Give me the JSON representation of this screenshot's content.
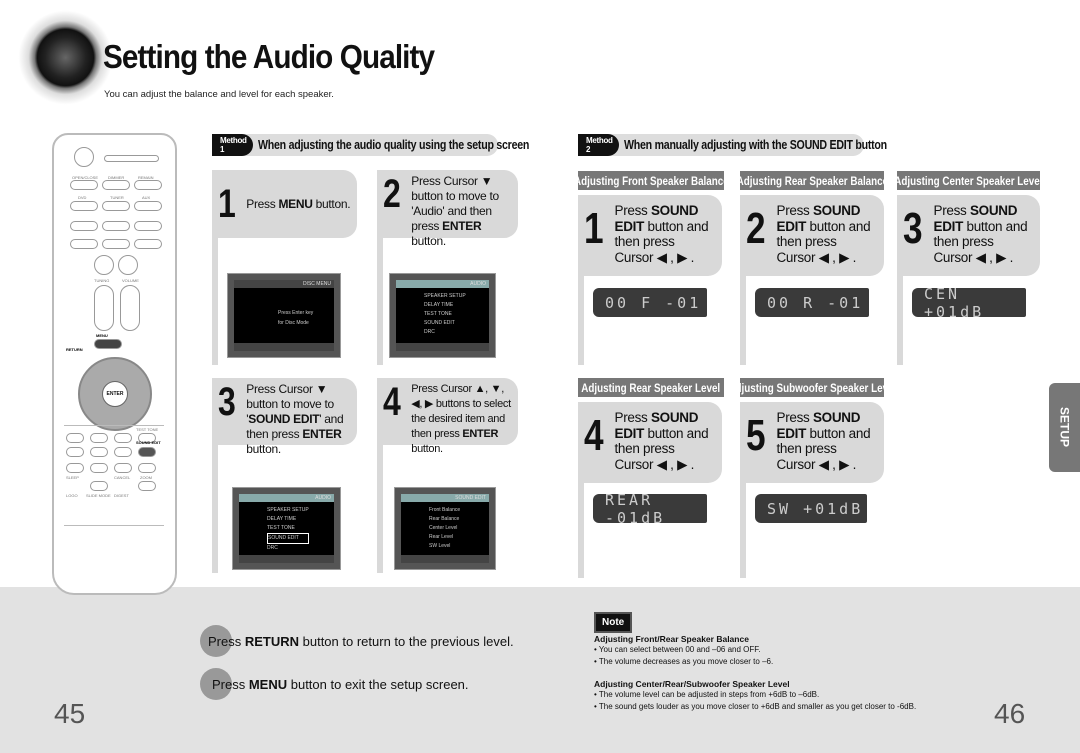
{
  "header": {
    "title": "Setting the Audio Quality",
    "subtitle": "You can adjust the balance and level for each speaker."
  },
  "method1": {
    "tag": "Method 1",
    "title": "When adjusting the audio quality using the setup screen",
    "steps": [
      {
        "num": "1",
        "text": "Press MENU button."
      },
      {
        "num": "2",
        "text": "Press Cursor ▼ button to move to 'Audio' and then press ENTER button."
      },
      {
        "num": "3",
        "text": "Press Cursor ▼ button to move to 'SOUND EDIT' and then press ENTER button."
      },
      {
        "num": "4",
        "text": "Press Cursor ▲, ▼, ◀, ▶ buttons to select the desired item and then press ENTER button."
      }
    ],
    "screens": [
      {
        "header": "DISC MENU",
        "items": [
          "Press Enter key",
          "for Disc Mode"
        ]
      },
      {
        "header": "AUDIO",
        "items": [
          "SPEAKER SETUP",
          "DELAY TIME",
          "TEST TONE",
          "SOUND EDIT",
          "DRC"
        ]
      },
      {
        "header": "AUDIO",
        "items": [
          "SPEAKER SETUP",
          "DELAY TIME",
          "TEST TONE",
          "SOUND EDIT",
          "DRC"
        ]
      },
      {
        "header": "SOUND EDIT",
        "items": [
          "Front Balance",
          "Rear Balance",
          "Center Level",
          "Rear Level",
          "SW Level"
        ]
      }
    ]
  },
  "method2": {
    "tag": "Method 2",
    "title": "When manually adjusting with the SOUND EDIT button",
    "sections": [
      {
        "header": "Adjusting Front Speaker Balance",
        "num": "1",
        "display": "00 F -01"
      },
      {
        "header": "Adjusting Rear Speaker Balance",
        "num": "2",
        "display": "00 R -01"
      },
      {
        "header": "Adjusting Center Speaker Level",
        "num": "3",
        "display": "CEN +01dB"
      },
      {
        "header": "Adjusting Rear Speaker Level",
        "num": "4",
        "display": "REAR -01dB"
      },
      {
        "header": "Adjusting Subwoofer Speaker Level",
        "num": "5",
        "display": "SW +01dB"
      }
    ],
    "step_text": "Press SOUND EDIT button and then press Cursor ◀ , ▶ ."
  },
  "side_tab": "SETUP",
  "bottom": {
    "return_text": "Press RETURN button to return to the previous level.",
    "menu_text": "Press MENU button to exit the setup screen."
  },
  "note": {
    "label": "Note",
    "groups": [
      {
        "heading": "Adjusting Front/Rear Speaker Balance",
        "items": [
          "You can select between 00 and –06 and OFF.",
          "The volume decreases as you move closer to –6."
        ]
      },
      {
        "heading": "Adjusting Center/Rear/Subwoofer Speaker Level",
        "items": [
          "The volume level can be adjusted in steps from +6dB to –6dB.",
          "The sound gets louder as you move closer to +6dB and smaller as you get closer to -6dB."
        ]
      }
    ]
  },
  "pages": {
    "left": "45",
    "right": "46"
  },
  "remote": {
    "labels": [
      "OPEN/CLOSE",
      "DIMMER",
      "REMAIN",
      "DVD",
      "TUNER",
      "AUX",
      "TUNING",
      "VOLUME",
      "MENU",
      "RETURN",
      "ENTER",
      "TEST TONE",
      "SOUND EDIT",
      "SLEEP",
      "CANCEL",
      "ZOOM",
      "LOGO",
      "SLIDE MODE",
      "DIGEST"
    ]
  }
}
